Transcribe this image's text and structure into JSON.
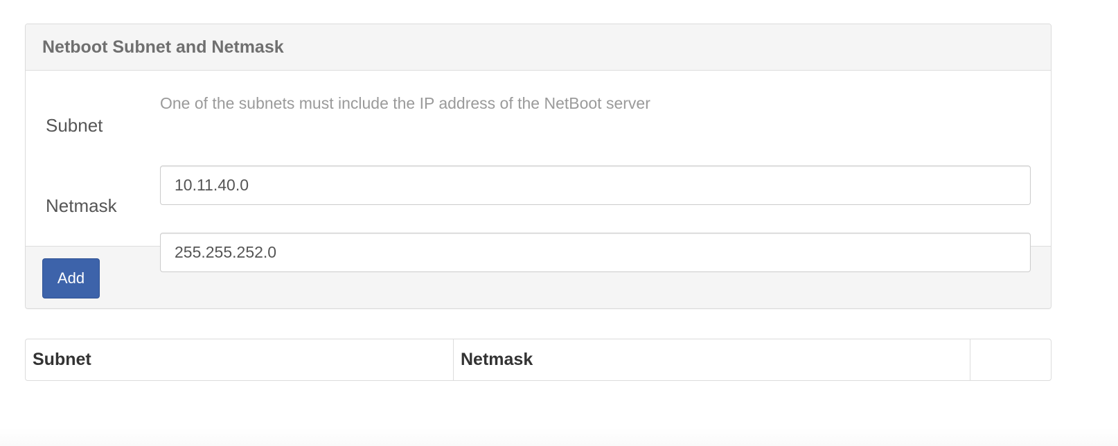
{
  "panel": {
    "title": "Netboot Subnet and Netmask",
    "help_text": "One of the subnets must include the IP address of the NetBoot server",
    "subnet_label": "Subnet",
    "subnet_value": "10.11.40.0",
    "netmask_label": "Netmask",
    "netmask_value": "255.255.252.0",
    "add_label": "Add"
  },
  "table": {
    "columns": [
      "Subnet",
      "Netmask",
      ""
    ]
  },
  "colors": {
    "primary_button": "#3d63aa",
    "panel_heading_bg": "#f5f5f5",
    "border": "#dcdcdc"
  }
}
